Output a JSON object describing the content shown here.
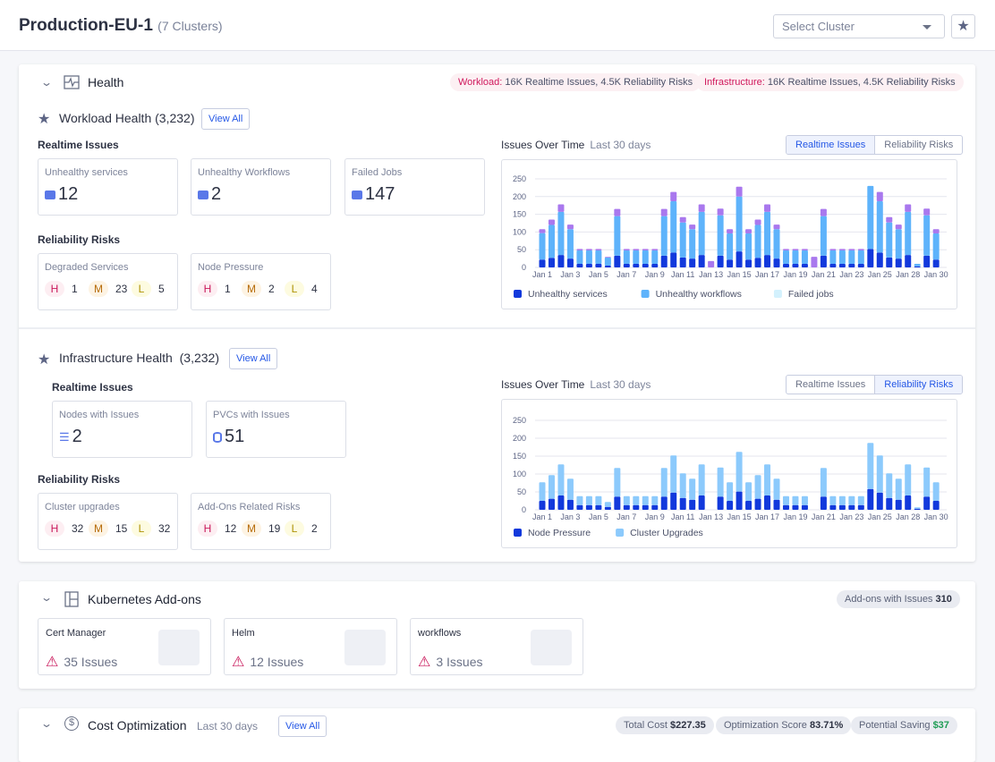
{
  "header": {
    "title": "Production-EU-1",
    "subtitle": "(7 Clusters)",
    "select_placeholder": "Select Cluster",
    "star_icon": "star-icon"
  },
  "health": {
    "title": "Health",
    "pills": [
      {
        "label": "Workload:",
        "text": " 16K Realtime Issues, 4.5K Reliability Risks"
      },
      {
        "label": "Infrastructure:",
        "text": " 16K Realtime Issues, 4.5K Reliability Risks"
      }
    ],
    "workload": {
      "title": "Workload Health (3,232)",
      "view_all": "View All",
      "realtime_label": "Realtime Issues",
      "realtime": [
        {
          "title": "Unhealthy services",
          "value": "12"
        },
        {
          "title": "Unhealthy Workflows",
          "value": "2"
        },
        {
          "title": "Failed Jobs",
          "value": "147"
        }
      ],
      "risk_label": "Reliability Risks",
      "risks": [
        {
          "title": "Degraded Services",
          "h": "1",
          "m": "23",
          "l": "5"
        },
        {
          "title": "Node Pressure",
          "h": "1",
          "m": "2",
          "l": "4"
        }
      ],
      "chart_title": "Issues Over Time",
      "chart_period": "Last 30 days",
      "toggle": [
        "Realtime Issues",
        "Reliability Risks"
      ],
      "toggle_active": 0
    },
    "infra": {
      "title": "Infrastructure Health",
      "count": "(3,232)",
      "view_all": "View All",
      "realtime_label": "Realtime Issues",
      "realtime": [
        {
          "title": "Nodes with Issues",
          "value": "2"
        },
        {
          "title": "PVCs with Issues",
          "value": "51"
        }
      ],
      "risk_label": "Reliability Risks",
      "risks": [
        {
          "title": "Cluster upgrades",
          "h": "32",
          "m": "15",
          "l": "32"
        },
        {
          "title": "Add-Ons Related Risks",
          "h": "12",
          "m": "19",
          "l": "2"
        }
      ],
      "chart_title": "Issues Over Time",
      "chart_period": "Last 30 days",
      "toggle": [
        "Realtime Issues",
        "Reliability Risks"
      ],
      "toggle_active": 1
    },
    "badges": {
      "h": "H",
      "m": "M",
      "l": "L"
    }
  },
  "addons": {
    "title": "Kubernetes Add-ons",
    "summary_label": "Add-ons with Issues",
    "summary_value": "310",
    "items": [
      {
        "name": "Cert Manager",
        "issues": "35 Issues"
      },
      {
        "name": "Helm",
        "issues": "12 Issues"
      },
      {
        "name": "workflows",
        "issues": "3 Issues"
      }
    ]
  },
  "cost": {
    "title": "Cost Optimization",
    "period": "Last 30 days",
    "view_all": "View All",
    "pills": [
      {
        "label": "Total Cost",
        "value": "$227.35"
      },
      {
        "label": "Optimization Score",
        "value": "83.71%"
      },
      {
        "label": "Potential Saving",
        "value": "$37"
      }
    ]
  },
  "chart_data": [
    {
      "type": "bar",
      "stacked": true,
      "ylim": [
        0,
        250
      ],
      "yticks": [
        0,
        50,
        100,
        150,
        200,
        250
      ],
      "grid": true,
      "legend": "bottom-left",
      "xtick_labels": [
        "Jan 1",
        "Jan 3",
        "Jan 5",
        "Jan 7",
        "Jan 9",
        "Jan 11",
        "Jan 13",
        "Jan 15",
        "Jan 17",
        "Jan 19",
        "Jan 21",
        "Jan 23",
        "Jan 25",
        "Jan 28",
        "Jan 30"
      ],
      "series": [
        {
          "name": "Unhealthy services",
          "color": "#1239dc",
          "values": [
            22,
            27,
            35,
            25,
            10,
            10,
            10,
            5,
            33,
            10,
            10,
            10,
            10,
            33,
            42,
            28,
            25,
            35,
            0,
            33,
            22,
            45,
            22,
            27,
            35,
            25,
            10,
            10,
            10,
            0,
            33,
            10,
            10,
            10,
            10,
            52,
            42,
            28,
            25,
            35,
            3,
            33,
            22
          ]
        },
        {
          "name": "Unhealthy workflows",
          "color": "#5eb3fb",
          "values": [
            75,
            93,
            122,
            83,
            38,
            38,
            38,
            23,
            112,
            38,
            38,
            38,
            38,
            112,
            145,
            99,
            83,
            122,
            0,
            114,
            74,
            155,
            74,
            93,
            122,
            83,
            38,
            38,
            38,
            0,
            112,
            38,
            38,
            38,
            38,
            178,
            145,
            99,
            83,
            122,
            7,
            114,
            74
          ]
        },
        {
          "name": "Failed jobs",
          "color": "#d3f1fd",
          "values": [
            0,
            0,
            0,
            0,
            0,
            0,
            0,
            0,
            0,
            0,
            0,
            0,
            0,
            0,
            0,
            0,
            0,
            0,
            0,
            0,
            0,
            0,
            0,
            0,
            0,
            0,
            0,
            0,
            0,
            0,
            0,
            0,
            0,
            0,
            0,
            0,
            0,
            0,
            0,
            0,
            0,
            0,
            0
          ]
        },
        {
          "name": "",
          "color": "#a978ee",
          "values": [
            11,
            15,
            21,
            13,
            4,
            4,
            4,
            2,
            20,
            4,
            4,
            4,
            4,
            20,
            26,
            15,
            13,
            21,
            18,
            19,
            12,
            28,
            12,
            15,
            21,
            13,
            4,
            4,
            4,
            30,
            20,
            4,
            4,
            4,
            4,
            0,
            26,
            15,
            13,
            21,
            0,
            19,
            12
          ]
        }
      ]
    },
    {
      "type": "bar",
      "stacked": true,
      "ylim": [
        0,
        250
      ],
      "yticks": [
        0,
        50,
        100,
        150,
        200,
        250
      ],
      "grid": true,
      "legend": "bottom-left",
      "xtick_labels": [
        "Jan 1",
        "Jan 3",
        "Jan 5",
        "Jan 7",
        "Jan 9",
        "Jan 11",
        "Jan 13",
        "Jan 15",
        "Jan 17",
        "Jan 19",
        "Jan 21",
        "Jan 23",
        "Jan 25",
        "Jan 28",
        "Jan 30"
      ],
      "series": [
        {
          "name": "Node Pressure",
          "color": "#1239dc",
          "values": [
            25,
            31,
            40,
            28,
            13,
            13,
            13,
            8,
            37,
            13,
            13,
            13,
            13,
            37,
            48,
            33,
            28,
            40,
            0,
            37,
            25,
            51,
            25,
            31,
            40,
            28,
            13,
            13,
            13,
            0,
            37,
            13,
            13,
            13,
            13,
            58,
            48,
            33,
            28,
            40,
            3,
            37,
            25
          ]
        },
        {
          "name": "Cluster Upgrades",
          "color": "#8ccafc",
          "values": [
            52,
            66,
            87,
            59,
            25,
            25,
            25,
            14,
            80,
            25,
            25,
            25,
            25,
            80,
            104,
            69,
            59,
            87,
            0,
            81,
            52,
            111,
            52,
            66,
            87,
            59,
            25,
            25,
            25,
            0,
            80,
            25,
            25,
            25,
            25,
            129,
            104,
            69,
            59,
            87,
            4,
            81,
            52
          ]
        }
      ]
    }
  ]
}
